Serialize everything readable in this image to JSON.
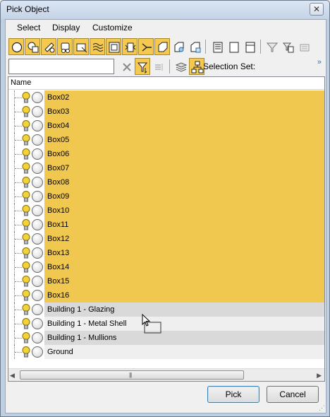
{
  "window": {
    "title": "Pick Object",
    "close_glyph": "✕"
  },
  "menu": {
    "items": [
      "Select",
      "Display",
      "Customize"
    ]
  },
  "toolbar": {
    "search": {
      "value": "",
      "placeholder": ""
    },
    "selection_set_label": "Selection Set:",
    "more_glyph": "»"
  },
  "list": {
    "column_header": "Name",
    "rows": [
      {
        "name": "Box02",
        "state": "selected"
      },
      {
        "name": "Box03",
        "state": "selected"
      },
      {
        "name": "Box04",
        "state": "selected"
      },
      {
        "name": "Box05",
        "state": "selected"
      },
      {
        "name": "Box06",
        "state": "selected"
      },
      {
        "name": "Box07",
        "state": "selected"
      },
      {
        "name": "Box08",
        "state": "selected"
      },
      {
        "name": "Box09",
        "state": "selected"
      },
      {
        "name": "Box10",
        "state": "selected"
      },
      {
        "name": "Box11",
        "state": "selected"
      },
      {
        "name": "Box12",
        "state": "selected"
      },
      {
        "name": "Box13",
        "state": "selected"
      },
      {
        "name": "Box14",
        "state": "selected"
      },
      {
        "name": "Box15",
        "state": "selected"
      },
      {
        "name": "Box16",
        "state": "selected"
      },
      {
        "name": "Building 1 - Glazing",
        "state": "alt"
      },
      {
        "name": "Building 1 - Metal Shell",
        "state": "plain"
      },
      {
        "name": "Building 1 - Mullions",
        "state": "alt"
      },
      {
        "name": "Ground",
        "state": "plain"
      }
    ]
  },
  "buttons": {
    "pick": "Pick",
    "cancel": "Cancel"
  },
  "colors": {
    "selection": "#f0c850",
    "toggle_on": "#f5c94f",
    "row_alt": "#d9d9d9"
  }
}
